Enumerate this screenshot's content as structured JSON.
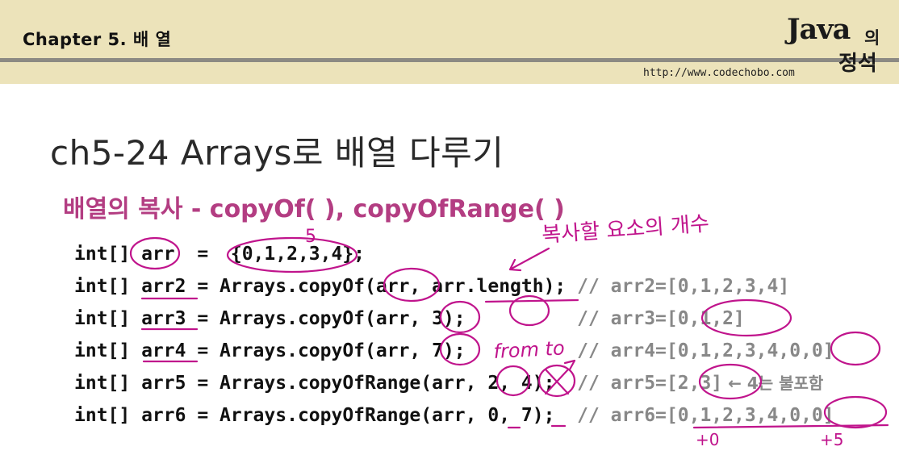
{
  "header": {
    "chapter": "Chapter 5. 배 열",
    "logo_main": "Java",
    "logo_small": "의",
    "logo_sub": "정석",
    "url": "http://www.codechobo.com"
  },
  "title": "ch5-24 Arrays로 배열 다루기",
  "subtitle": "배열의 복사 - copyOf( ), copyOfRange( )",
  "code_lines": [
    {
      "code": "int[] arr  =  {0,1,2,3,4};",
      "comment": "",
      "note": ""
    },
    {
      "code": "int[] arr2 = Arrays.copyOf(arr, arr.length); ",
      "comment": "// arr2=[0,1,2,3,4]",
      "note": ""
    },
    {
      "code": "int[] arr3 = Arrays.copyOf(arr, 3);          ",
      "comment": "// arr3=[0,1,2]",
      "note": ""
    },
    {
      "code": "int[] arr4 = Arrays.copyOf(arr, 7);          ",
      "comment": "// arr4=[0,1,2,3,4,0,0]",
      "note": ""
    },
    {
      "code": "int[] arr5 = Arrays.copyOfRange(arr, 2, 4);  ",
      "comment": "// arr5=[2,3]",
      "note": " ← 4는 불포함"
    },
    {
      "code": "int[] arr6 = Arrays.copyOfRange(arr, 0, 7);  ",
      "comment": "// arr6=[0,1,2,3,4,0,0]",
      "note": ""
    }
  ],
  "handwriting": {
    "element_count": "복사할 요소의 개수",
    "from_to": "from  to",
    "count_5": "5",
    "from_mark": "+0",
    "to_mark": "+5"
  },
  "colors": {
    "header_bg": "#ece3ba",
    "accent_magenta": "#b33d82",
    "ink_magenta": "#c0148c",
    "comment_gray": "#888888"
  }
}
